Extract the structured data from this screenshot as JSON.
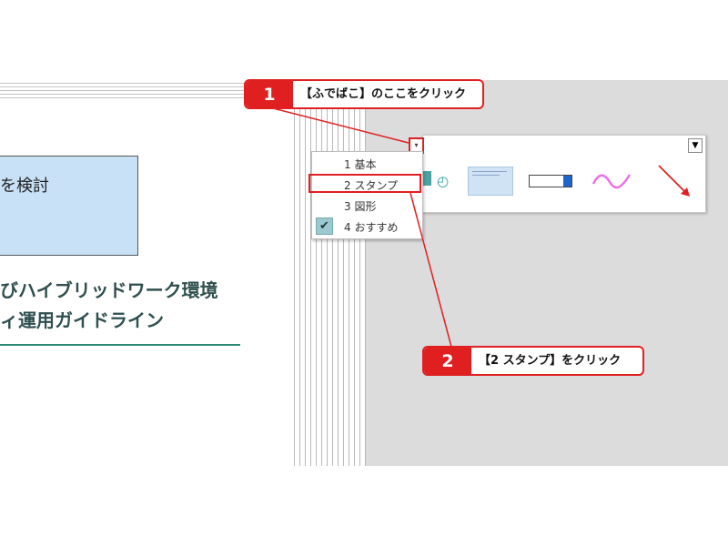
{
  "slide": {
    "box_text": "を検討",
    "title_line1": "びハイブリッドワーク環境",
    "title_line2": "ィ運用ガイドライン"
  },
  "menu": {
    "items": [
      {
        "label": "1 基本"
      },
      {
        "label": "2 スタンプ"
      },
      {
        "label": "3 図形"
      },
      {
        "label": "4 おすすめ"
      }
    ]
  },
  "panel": {
    "history_icon": "history-icon",
    "pin_icon": "pin-icon"
  },
  "callouts": [
    {
      "number": "1",
      "text": "【ふでばこ】のここをクリック"
    },
    {
      "number": "2",
      "text": "【2 スタンプ】をクリック"
    }
  ],
  "colors": {
    "accent_red": "#e02020",
    "slide_box": "#c8e1f7",
    "teal": "#2a9a9a"
  }
}
